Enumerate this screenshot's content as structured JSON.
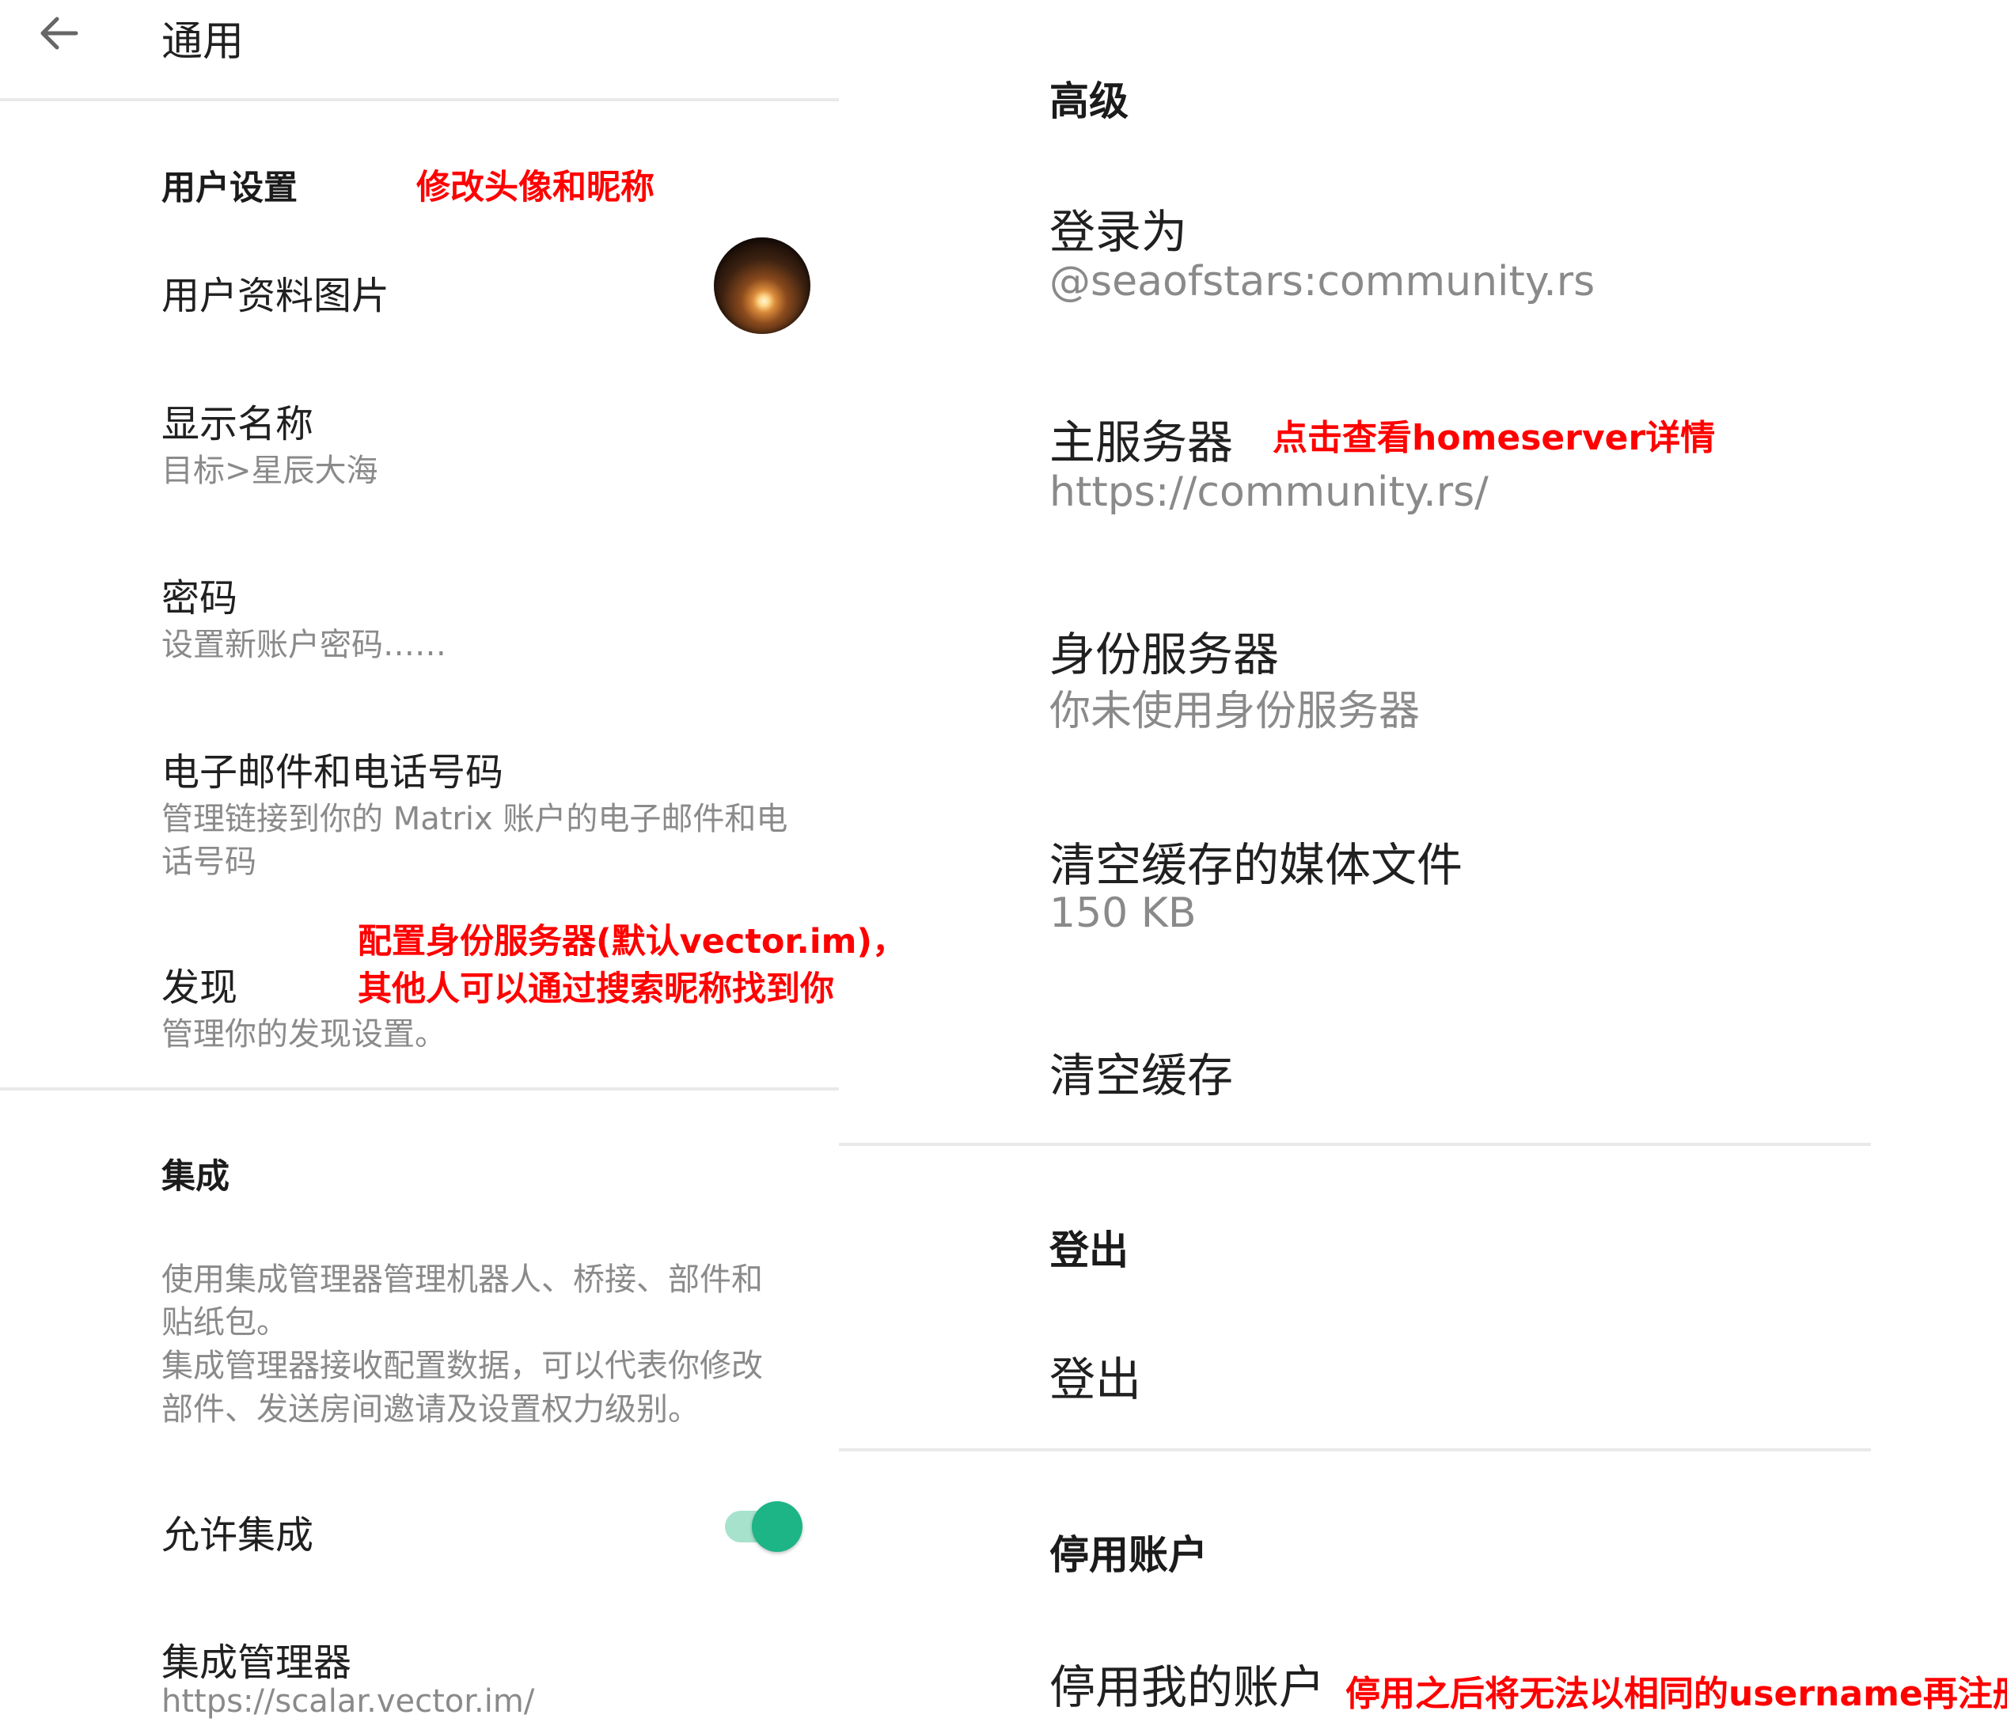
{
  "left": {
    "header": {
      "title": "通用"
    },
    "user_settings": {
      "section_title": "用户设置",
      "annotation": "修改头像和昵称",
      "profile_picture": {
        "title": "用户资料图片"
      },
      "display_name": {
        "title": "显示名称",
        "value": "目标>星辰大海"
      },
      "password": {
        "title": "密码",
        "subtitle": "设置新账户密码……"
      },
      "email_phone": {
        "title": "电子邮件和电话号码",
        "subtitle_line1": "管理链接到你的 Matrix 账户的电子邮件和电",
        "subtitle_line2": "话号码"
      },
      "discovery": {
        "title": "发现",
        "subtitle": "管理你的发现设置。",
        "annotation_line1": "配置身份服务器(默认vector.im)，",
        "annotation_line2": "其他人可以通过搜索昵称找到你"
      }
    },
    "integrations": {
      "section_title": "集成",
      "description_line1": "使用集成管理器管理机器人、桥接、部件和",
      "description_line2": "贴纸包。",
      "description_line3": "集成管理器接收配置数据，可以代表你修改",
      "description_line4": "部件、发送房间邀请及设置权力级别。",
      "allow": {
        "title": "允许集成",
        "enabled": true
      },
      "manager": {
        "title": "集成管理器",
        "value": "https://scalar.vector.im/"
      }
    }
  },
  "right": {
    "advanced": {
      "section_title": "高级",
      "logged_in_as": {
        "title": "登录为",
        "value": "@seaofstars:community.rs"
      },
      "homeserver": {
        "title": "主服务器",
        "value": "https://community.rs/",
        "annotation": "点击查看homeserver详情"
      },
      "identity_server": {
        "title": "身份服务器",
        "value": "你未使用身份服务器"
      },
      "clear_media": {
        "title": "清空缓存的媒体文件",
        "value": "150 KB"
      },
      "clear_cache": {
        "title": "清空缓存"
      }
    },
    "logout": {
      "section_title": "登出",
      "action": "登出"
    },
    "deactivate": {
      "section_title": "停用账户",
      "action": "停用我的账户",
      "annotation": "停用之后将无法以相同的username再注册！"
    }
  },
  "colors": {
    "toggle_on": "#1db586",
    "toggle_track": "#a7e3cc",
    "annotation": "#ff0000",
    "secondary_text": "#8a8a8a"
  }
}
